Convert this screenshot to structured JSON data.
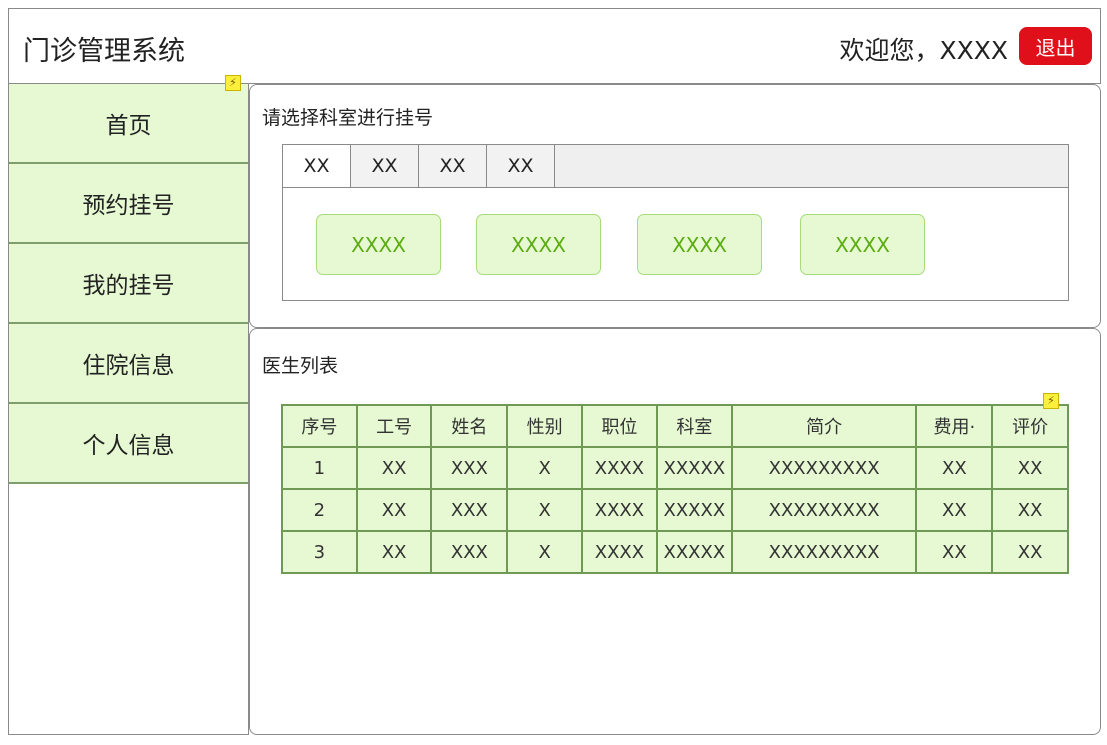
{
  "header": {
    "title": "门诊管理系统",
    "welcome": "欢迎您，XXXX",
    "logout_label": "退出"
  },
  "sidebar": {
    "items": [
      {
        "label": "首页"
      },
      {
        "label": "预约挂号"
      },
      {
        "label": "我的挂号"
      },
      {
        "label": "住院信息"
      },
      {
        "label": "个人信息"
      }
    ]
  },
  "department_panel": {
    "title": "请选择科室进行挂号",
    "tabs": [
      "XX",
      "XX",
      "XX",
      "XX"
    ],
    "departments": [
      "XXXX",
      "XXXX",
      "XXXX",
      "XXXX"
    ]
  },
  "doctor_panel": {
    "title": "医生列表",
    "columns": [
      "序号",
      "工号",
      "姓名",
      "性别",
      "职位",
      "科室",
      "简介",
      "费用·",
      "评价"
    ],
    "rows": [
      [
        "1",
        "XX",
        "XXX",
        "X",
        "XXXX",
        "XXXXX",
        "XXXXXXXXX",
        "XX",
        "XX"
      ],
      [
        "2",
        "XX",
        "XXX",
        "X",
        "XXXX",
        "XXXXX",
        "XXXXXXXXX",
        "XX",
        "XX"
      ],
      [
        "3",
        "XX",
        "XXX",
        "X",
        "XXXX",
        "XXXXX",
        "XXXXXXXXX",
        "XX",
        "XX"
      ]
    ]
  },
  "colors": {
    "accent_green": "#e6f9d2",
    "dept_text_green": "#5aac10",
    "logout_red": "#e0101a",
    "badge_yellow": "#ffef3d"
  },
  "icons": {
    "badge": "lightning-bolt-icon"
  }
}
